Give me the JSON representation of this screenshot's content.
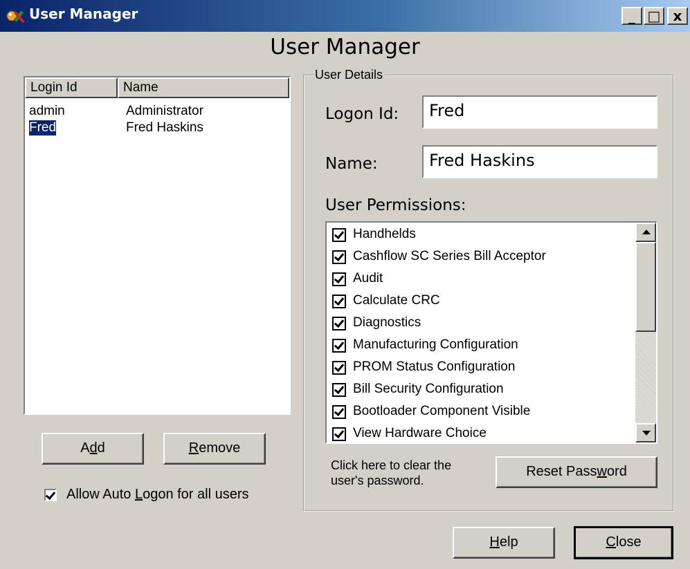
{
  "window": {
    "title": "User Manager",
    "controls": {
      "minimize": "_",
      "maximize": "□",
      "close": "x"
    }
  },
  "header": {
    "title": "User Manager"
  },
  "user_list": {
    "columns": [
      "Login Id",
      "Name"
    ],
    "rows": [
      {
        "login": "admin",
        "name": "Administrator",
        "selected": false
      },
      {
        "login": "Fred",
        "name": "Fred Haskins",
        "selected": true
      }
    ]
  },
  "buttons": {
    "add": {
      "pre": "A",
      "mnemonic": "d",
      "post": "d"
    },
    "remove": {
      "pre": "",
      "mnemonic": "R",
      "post": "emove"
    },
    "reset_password": {
      "pre": "Reset Pass",
      "mnemonic": "w",
      "post": "ord"
    },
    "help": {
      "pre": "",
      "mnemonic": "H",
      "post": "elp"
    },
    "close": {
      "pre": "",
      "mnemonic": "C",
      "post": "lose"
    }
  },
  "auto_logon": {
    "checked": true,
    "label_pre": "Allow Auto ",
    "label_mnemonic": "L",
    "label_post": "ogon for all users"
  },
  "user_details": {
    "legend": "User Details",
    "logon_id_label": "Logon Id:",
    "logon_id_value": "Fred",
    "name_label": "Name:",
    "name_value": "Fred Haskins",
    "permissions_label": "User Permissions:",
    "permissions": [
      {
        "label": "Handhelds",
        "checked": true
      },
      {
        "label": "Cashflow SC Series Bill Acceptor",
        "checked": true
      },
      {
        "label": "Audit",
        "checked": true
      },
      {
        "label": "Calculate CRC",
        "checked": true
      },
      {
        "label": "Diagnostics",
        "checked": true
      },
      {
        "label": "Manufacturing Configuration",
        "checked": true
      },
      {
        "label": "PROM Status Configuration",
        "checked": true
      },
      {
        "label": "Bill Security Configuration",
        "checked": true
      },
      {
        "label": "Bootloader Component Visible",
        "checked": true
      },
      {
        "label": "View Hardware Choice",
        "checked": true
      }
    ],
    "reset_hint": "Click here to clear the user's password."
  },
  "colors": {
    "face": "#d4d0c8",
    "title_start": "#0a246a",
    "title_end": "#a6caf0",
    "selection": "#0a246a"
  }
}
